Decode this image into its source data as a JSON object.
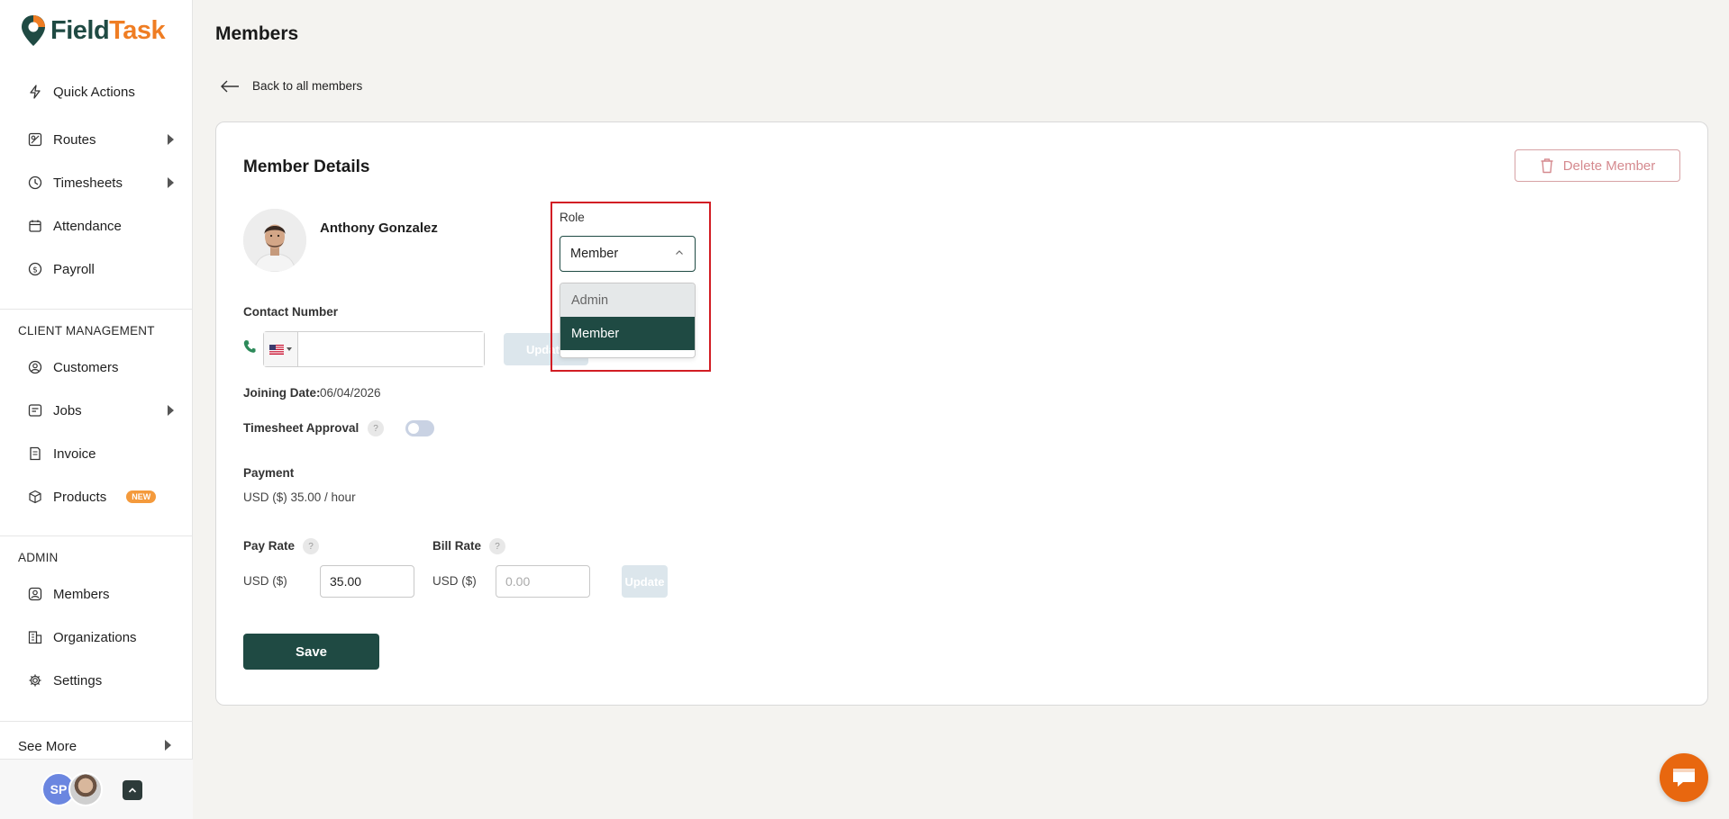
{
  "app": {
    "logo_part1": "Field",
    "logo_part2": "Task",
    "brand_green": "#1f4a43",
    "brand_orange": "#ef7d23"
  },
  "sidebar": {
    "items": [
      {
        "label": "Quick Actions",
        "icon": "bolt-icon"
      },
      {
        "label": "Routes",
        "icon": "map-icon",
        "expandable": true
      },
      {
        "label": "Timesheets",
        "icon": "clock-icon",
        "expandable": true
      },
      {
        "label": "Attendance",
        "icon": "calendar-icon"
      },
      {
        "label": "Payroll",
        "icon": "payroll-icon"
      }
    ],
    "client_section": "CLIENT MANAGEMENT",
    "client_items": [
      {
        "label": "Customers",
        "icon": "customer-icon"
      },
      {
        "label": "Jobs",
        "icon": "jobs-icon",
        "expandable": true
      },
      {
        "label": "Invoice",
        "icon": "invoice-icon"
      },
      {
        "label": "Products",
        "icon": "box-icon",
        "badge": "NEW"
      }
    ],
    "admin_section": "ADMIN",
    "admin_items": [
      {
        "label": "Members",
        "icon": "member-icon"
      },
      {
        "label": "Organizations",
        "icon": "building-icon"
      },
      {
        "label": "Settings",
        "icon": "gear-icon"
      }
    ],
    "see_more": "See More",
    "user_initials": "SP"
  },
  "page": {
    "title": "Members",
    "back_link": "Back to all members"
  },
  "member": {
    "card_title": "Member Details",
    "delete_label": "Delete Member",
    "name": "Anthony Gonzalez",
    "contact_label": "Contact Number",
    "contact_value": "",
    "update_label": "Update",
    "joining_label": "Joining Date:",
    "joining_value": "06/04/2026",
    "timesheet_label": "Timesheet Approval",
    "help_glyph": "?",
    "timesheet_enabled": false,
    "payment_label": "Payment",
    "payment_value": "USD ($) 35.00 / hour",
    "pay_rate_label": "Pay Rate",
    "pay_rate_currency": "USD ($)",
    "pay_rate_value": "35.00",
    "bill_rate_label": "Bill Rate",
    "bill_rate_currency": "USD ($)",
    "bill_rate_placeholder": "0.00",
    "save_label": "Save"
  },
  "role": {
    "label": "Role",
    "selected": "Member",
    "options": [
      "Admin",
      "Member"
    ],
    "highlight_color": "#d21d24"
  }
}
